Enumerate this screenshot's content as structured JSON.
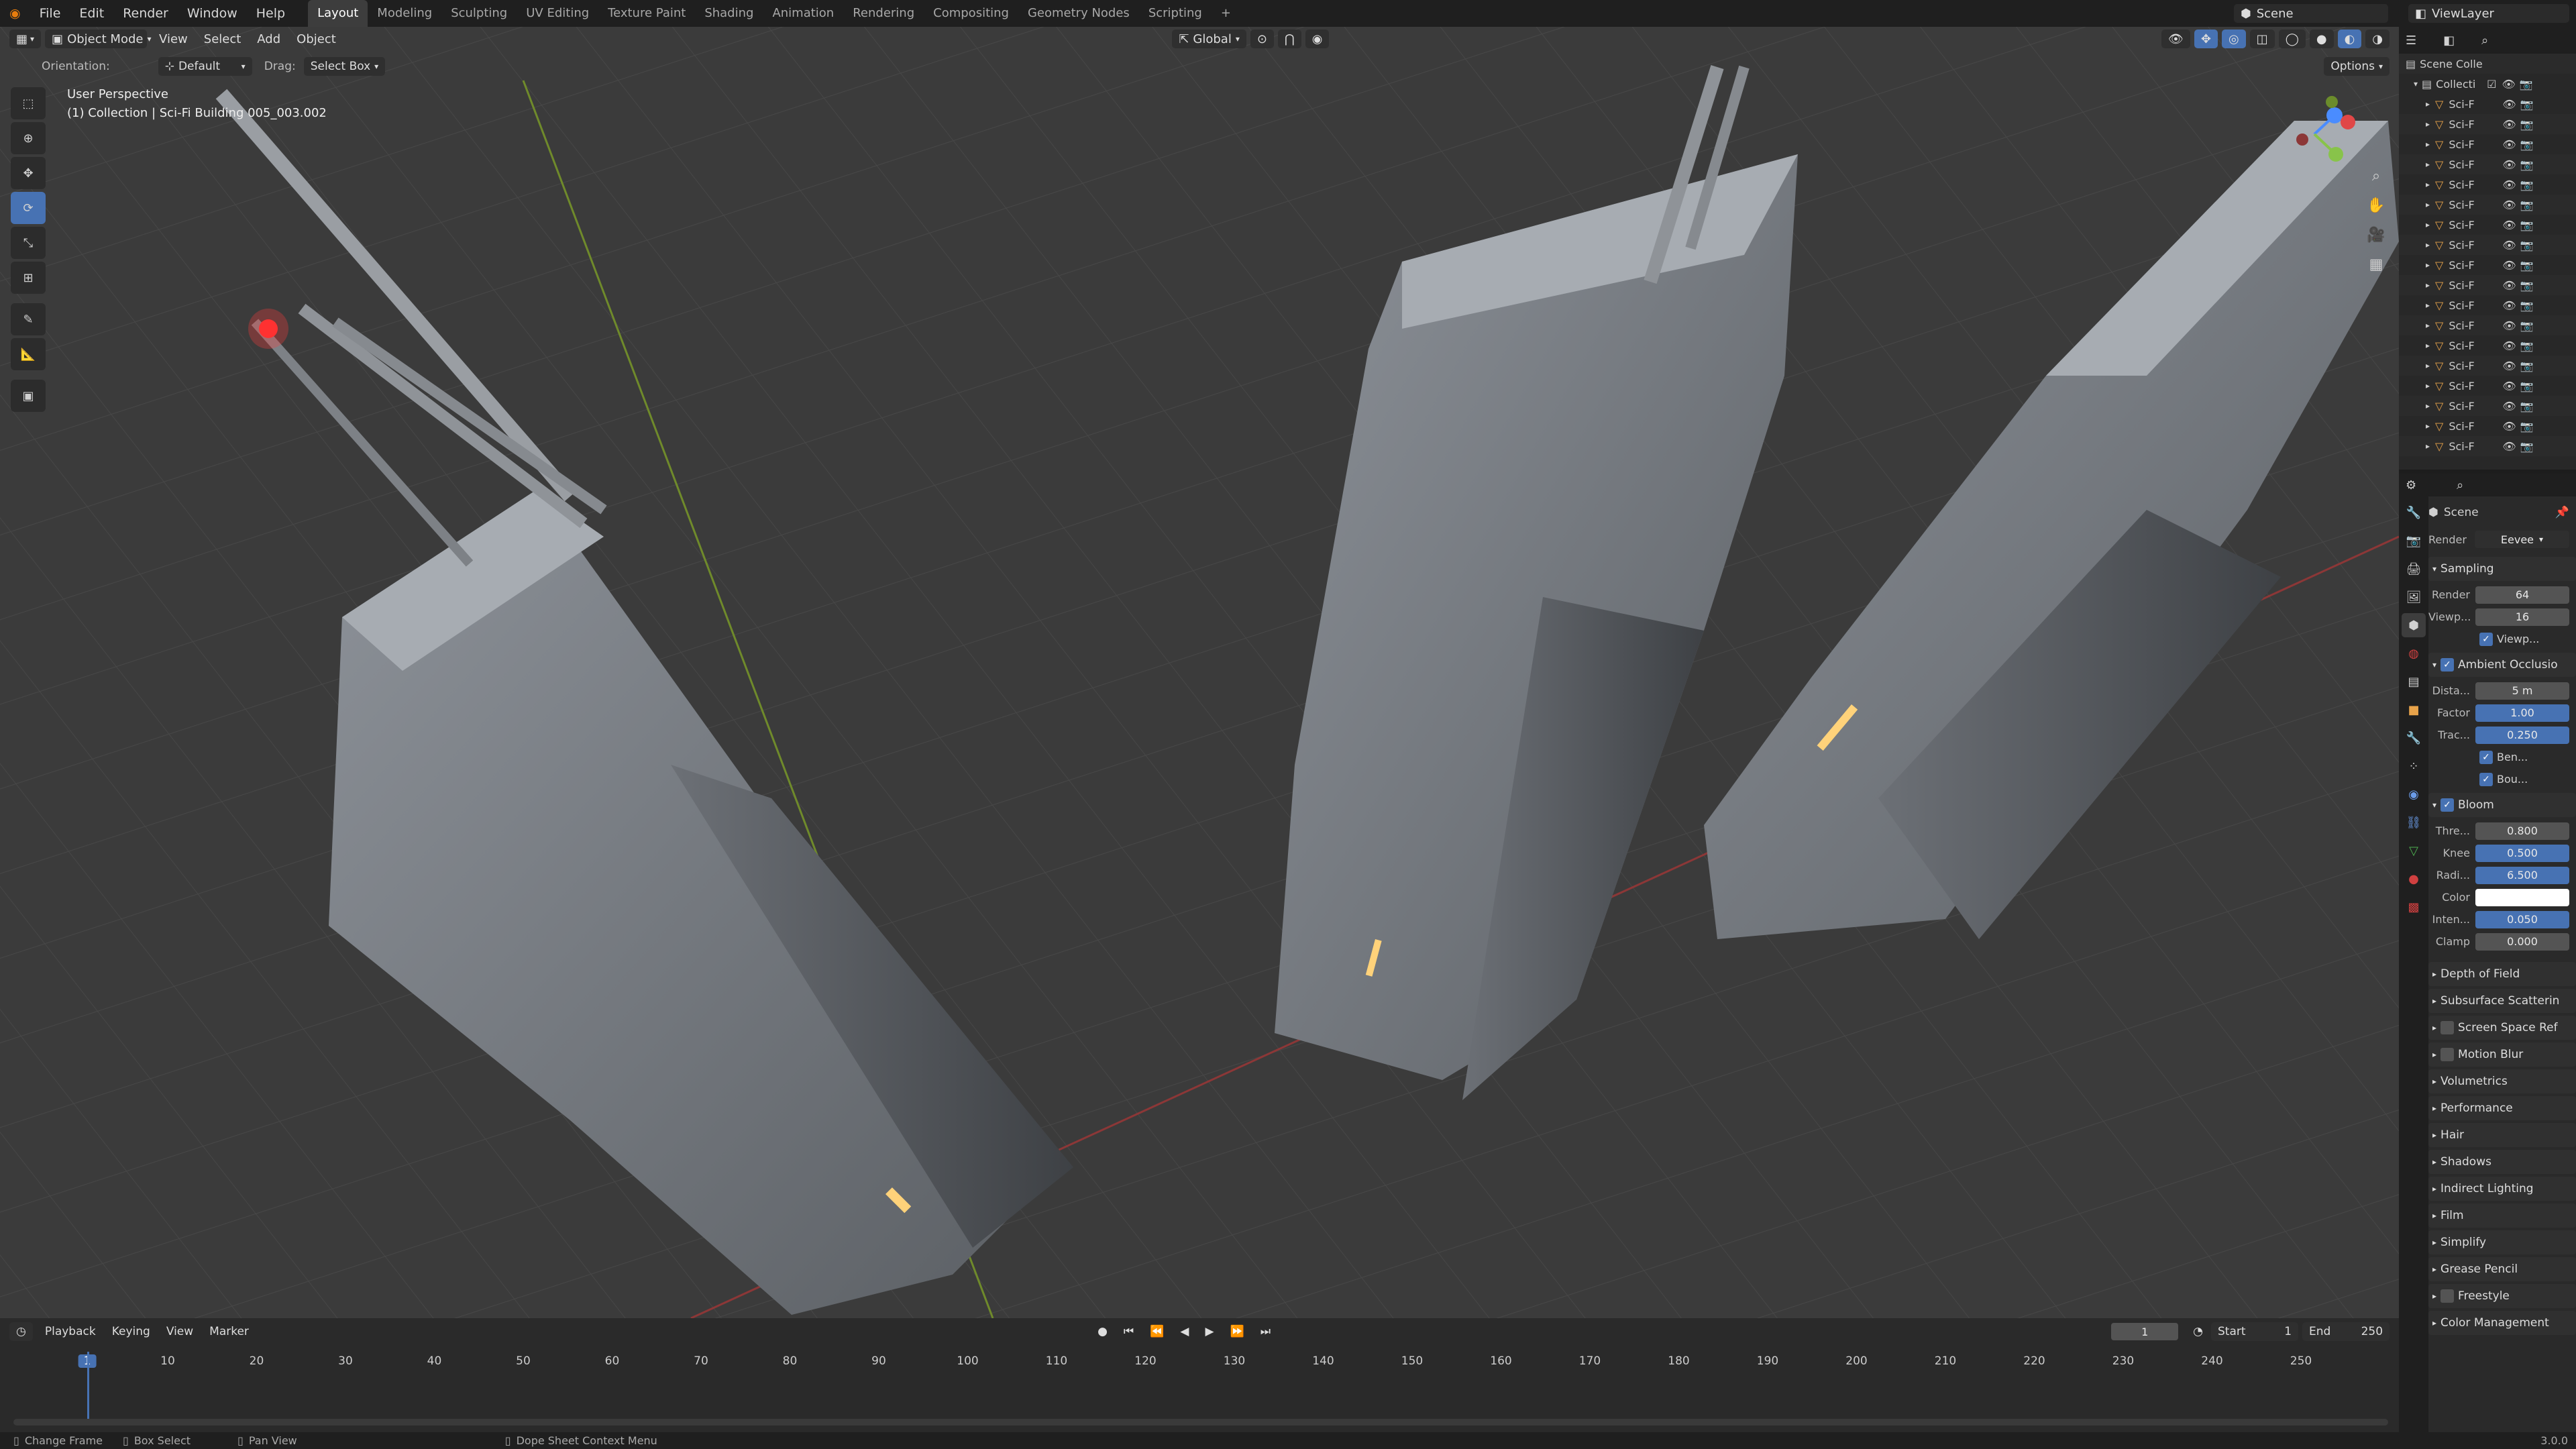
{
  "topbar": {
    "menus": [
      "File",
      "Edit",
      "Render",
      "Window",
      "Help"
    ],
    "workspaces": [
      "Layout",
      "Modeling",
      "Sculpting",
      "UV Editing",
      "Texture Paint",
      "Shading",
      "Animation",
      "Rendering",
      "Compositing",
      "Geometry Nodes",
      "Scripting"
    ],
    "active_workspace": "Layout",
    "scene": "Scene",
    "view_layer": "ViewLayer"
  },
  "viewport": {
    "mode": "Object Mode",
    "menus": [
      "View",
      "Select",
      "Add",
      "Object"
    ],
    "transform_orientation": "Global",
    "orientation_label": "Orientation:",
    "orientation_value": "Default",
    "drag_label": "Drag:",
    "drag_value": "Select Box",
    "options_label": "Options",
    "overlay_title": "User Perspective",
    "overlay_subtitle": "(1) Collection | Sci-Fi Building 005_003.002"
  },
  "outliner": {
    "root": "Scene Colle",
    "collection": "Collecti",
    "items": [
      "Sci-F",
      "Sci-F",
      "Sci-F",
      "Sci-F",
      "Sci-F",
      "Sci-F",
      "Sci-F",
      "Sci-F",
      "Sci-F",
      "Sci-F",
      "Sci-F",
      "Sci-F",
      "Sci-F",
      "Sci-F",
      "Sci-F",
      "Sci-F",
      "Sci-F",
      "Sci-F"
    ]
  },
  "properties": {
    "context": "Scene",
    "render_label": "Render",
    "render_engine": "Eevee",
    "sampling": {
      "title": "Sampling",
      "render_label": "Render",
      "render": "64",
      "viewport_label": "Viewp...",
      "viewport": "16",
      "viewport_denoise": "Viewp..."
    },
    "ao": {
      "title": "Ambient Occlusio",
      "distance_label": "Dista...",
      "distance": "5 m",
      "factor_label": "Factor",
      "factor": "1.00",
      "trace_label": "Trac...",
      "trace": "0.250",
      "bent": "Ben...",
      "bounce": "Bou..."
    },
    "bloom": {
      "title": "Bloom",
      "threshold_label": "Thre...",
      "threshold": "0.800",
      "knee_label": "Knee",
      "knee": "0.500",
      "radius_label": "Radi...",
      "radius": "6.500",
      "color_label": "Color",
      "intensity_label": "Inten...",
      "intensity": "0.050",
      "clamp_label": "Clamp",
      "clamp": "0.000"
    },
    "sections": [
      "Depth of Field",
      "Subsurface Scatterin",
      "Screen Space Ref",
      "Motion Blur",
      "Volumetrics",
      "Performance",
      "Hair",
      "Shadows",
      "Indirect Lighting",
      "Film",
      "Simplify",
      "Grease Pencil",
      "Freestyle",
      "Color Management"
    ]
  },
  "timeline": {
    "menus": [
      "Playback",
      "Keying",
      "View",
      "Marker"
    ],
    "current_frame": "1",
    "start_label": "Start",
    "start": "1",
    "end_label": "End",
    "end": "250",
    "ticks": [
      "1",
      "10",
      "20",
      "30",
      "40",
      "50",
      "60",
      "70",
      "80",
      "90",
      "100",
      "110",
      "120",
      "130",
      "140",
      "150",
      "160",
      "170",
      "180",
      "190",
      "200",
      "210",
      "220",
      "230",
      "240",
      "250"
    ]
  },
  "statusbar": {
    "change_frame": "Change Frame",
    "box_select": "Box Select",
    "pan_view": "Pan View",
    "context_menu": "Dope Sheet Context Menu",
    "version": "3.0.0"
  },
  "colors": {
    "accent": "#4772b3",
    "viewport_bg": "#3b3b3b",
    "panel_bg": "#2a2a2a"
  }
}
